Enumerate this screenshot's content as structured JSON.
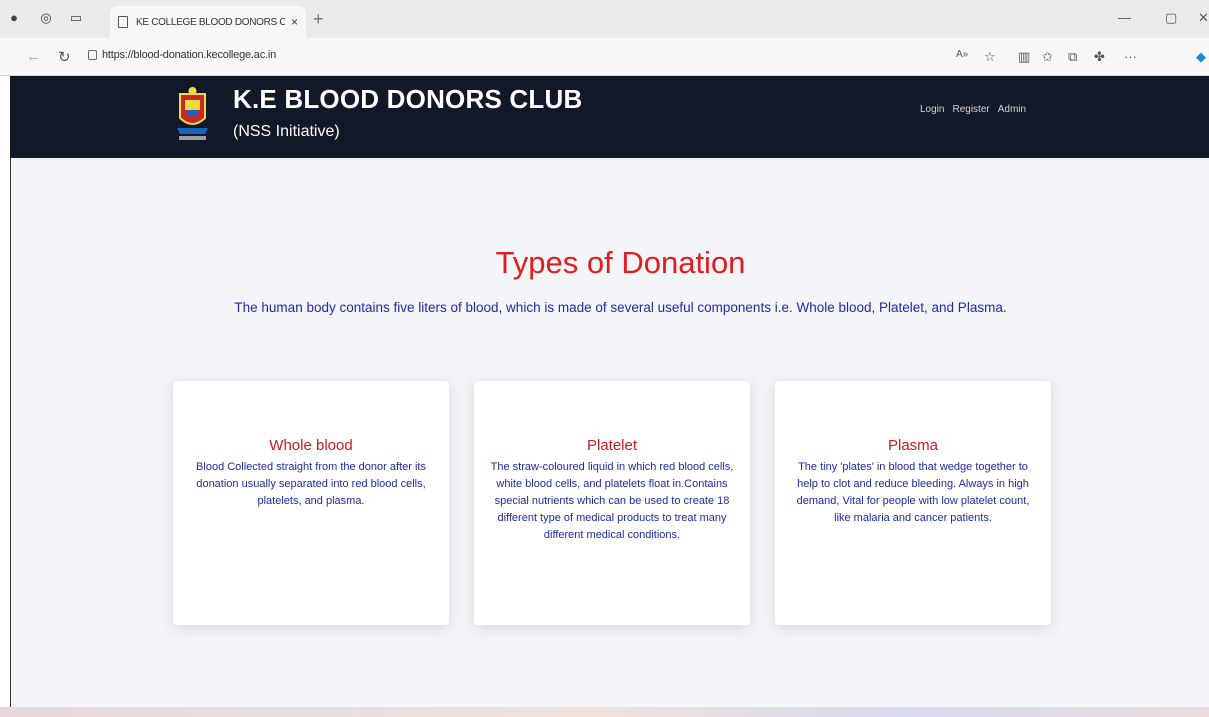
{
  "browser": {
    "tab_title": "KE COLLEGE BLOOD DONORS CL",
    "tab_close": "×",
    "new_tab": "+",
    "url": "https://blood-donation.kecollege.ac.in",
    "icons": [
      "profile-icon",
      "workspaces-icon",
      "tab-actions-icon",
      "page-icon",
      "back-icon",
      "refresh-icon",
      "lock-icon",
      "read-aloud-icon",
      "favorite-icon",
      "split-screen-icon",
      "favorites-icon",
      "collections-icon",
      "extensions-icon",
      "more-icon",
      "copilot-icon"
    ]
  },
  "header": {
    "brand": "K.E BLOOD DONORS CLUB",
    "tagline": "(NSS Initiative)",
    "nav": [
      "Login",
      "Register",
      "Admin"
    ],
    "bg_color": "#111827"
  },
  "main": {
    "title": "Types of Donation",
    "subtitle": "The human body contains five liters of blood, which is made of several useful components i.e. Whole blood, Platelet, and Plasma.",
    "cards": [
      {
        "heading": "Whole blood",
        "text": "Blood Collected straight from the donor after its donation usually separated into red blood cells, platelets, and plasma."
      },
      {
        "heading": "Platelet",
        "text": "The straw-coloured liquid in which red blood cells, white blood cells, and platelets float in.Contains special nutrients which can be used to create 18 different type of medical products to treat many different medical conditions."
      },
      {
        "heading": "Plasma",
        "text": "The tiny 'plates' in blood that wedge together to help to clot and reduce bleeding. Always in high demand, Vital for people with low platelet count, like malaria and cancer patients."
      }
    ]
  },
  "colors": {
    "title": "#e11d1d",
    "subtitle": "#1e2aa8",
    "background": "#f4f5f9"
  }
}
